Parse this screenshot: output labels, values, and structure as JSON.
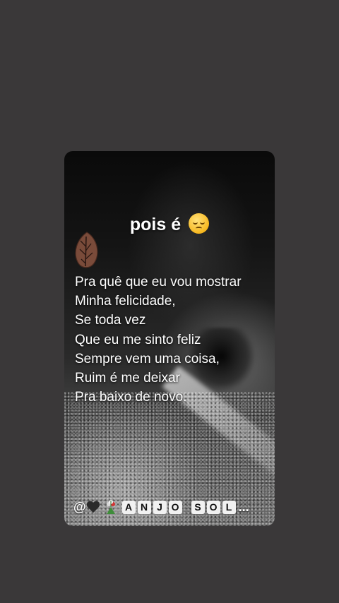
{
  "story": {
    "heading": "pois é",
    "heading_emoji": "pensive-face-emoji",
    "poem_lines": [
      "Pra quê que eu vou mostrar",
      "Minha felicidade,",
      "Se toda vez",
      "Que eu me sinto feliz",
      "Sempre vem uma coisa,",
      "Ruim é me deixar",
      "Pra baixo de novo."
    ],
    "author": {
      "at": "@",
      "icons": [
        "black-heart-icon",
        "bouquet-icon"
      ],
      "word1": [
        "A",
        "N",
        "J",
        "O"
      ],
      "word2": [
        "S",
        "O",
        "L"
      ],
      "ellipsis": "..."
    }
  },
  "colors": {
    "page_background": "#3a3839",
    "text": "#ffffff",
    "letter_tile": "#f1f1f1",
    "leaf": "#7a4b3a"
  }
}
